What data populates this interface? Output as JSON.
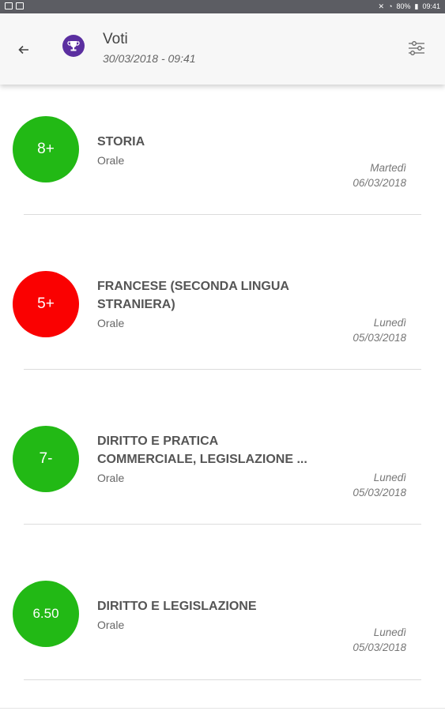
{
  "status_bar": {
    "battery": "80%",
    "time": "09:41"
  },
  "header": {
    "title": "Voti",
    "subtitle": "30/03/2018 - 09:41",
    "back_icon": "arrow-left-icon",
    "app_icon": "trophy-icon",
    "filter_icon": "sliders-icon"
  },
  "colors": {
    "pass": "#22b915",
    "fail": "#fa0101",
    "header_bg": "#f7f7f7",
    "accent": "#5b2fa0"
  },
  "grades": [
    {
      "grade": "8+",
      "subject": "STORIA",
      "subject_line2": "",
      "type": "Orale",
      "day": "Martedì",
      "date": "06/03/2018",
      "status": "pass"
    },
    {
      "grade": "5+",
      "subject": "FRANCESE (SECONDA LINGUA",
      "subject_line2": "STRANIERA)",
      "type": "Orale",
      "day": "Lunedì",
      "date": "05/03/2018",
      "status": "fail"
    },
    {
      "grade": "7-",
      "subject": "DIRITTO E PRATICA",
      "subject_line2": "COMMERCIALE, LEGISLAZIONE ...",
      "type": "Orale",
      "day": "Lunedì",
      "date": "05/03/2018",
      "status": "pass"
    },
    {
      "grade": "6.50",
      "subject": "DIRITTO E LEGISLAZIONE",
      "subject_line2": "",
      "type": "Orale",
      "day": "Lunedì",
      "date": "05/03/2018",
      "status": "pass"
    }
  ]
}
